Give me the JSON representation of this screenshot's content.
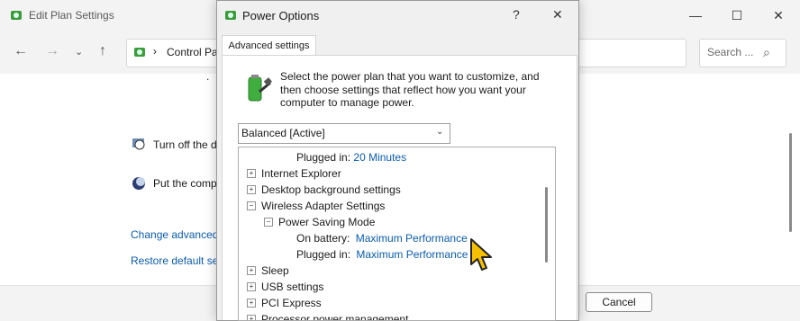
{
  "background_window": {
    "title": "Edit Plan Settings",
    "address": "Control Pa",
    "search_placeholder": "Search ...",
    "row_display": "Turn off the d",
    "row_sleep": "Put the comp",
    "link_advanced": "Change advanced",
    "link_restore": "Restore default set",
    "cancel_label": "Cancel",
    "dot": "."
  },
  "dialog": {
    "title": "Power Options",
    "help": "?",
    "close": "✕",
    "tab": "Advanced settings",
    "intro": "Select the power plan that you want to customize, and then choose settings that reflect how you want your computer to manage power.",
    "plan_selected": "Balanced [Active]",
    "tree": {
      "plugged_in_top_label": "Plugged in:",
      "plugged_in_top_value": "20 Minutes",
      "internet_explorer": "Internet Explorer",
      "desktop_background": "Desktop background settings",
      "wireless_adapter": "Wireless Adapter Settings",
      "power_saving_mode": "Power Saving Mode",
      "on_battery_label": "On battery:",
      "on_battery_value": "Maximum Performance",
      "plugged_in_label": "Plugged in:",
      "plugged_in_value": "Maximum Performance",
      "sleep": "Sleep",
      "usb_settings": "USB settings",
      "pci_express": "PCI Express",
      "processor": "Processor power management"
    }
  },
  "colors": {
    "link": "#0b5cad",
    "cursor": "#f5c000"
  }
}
